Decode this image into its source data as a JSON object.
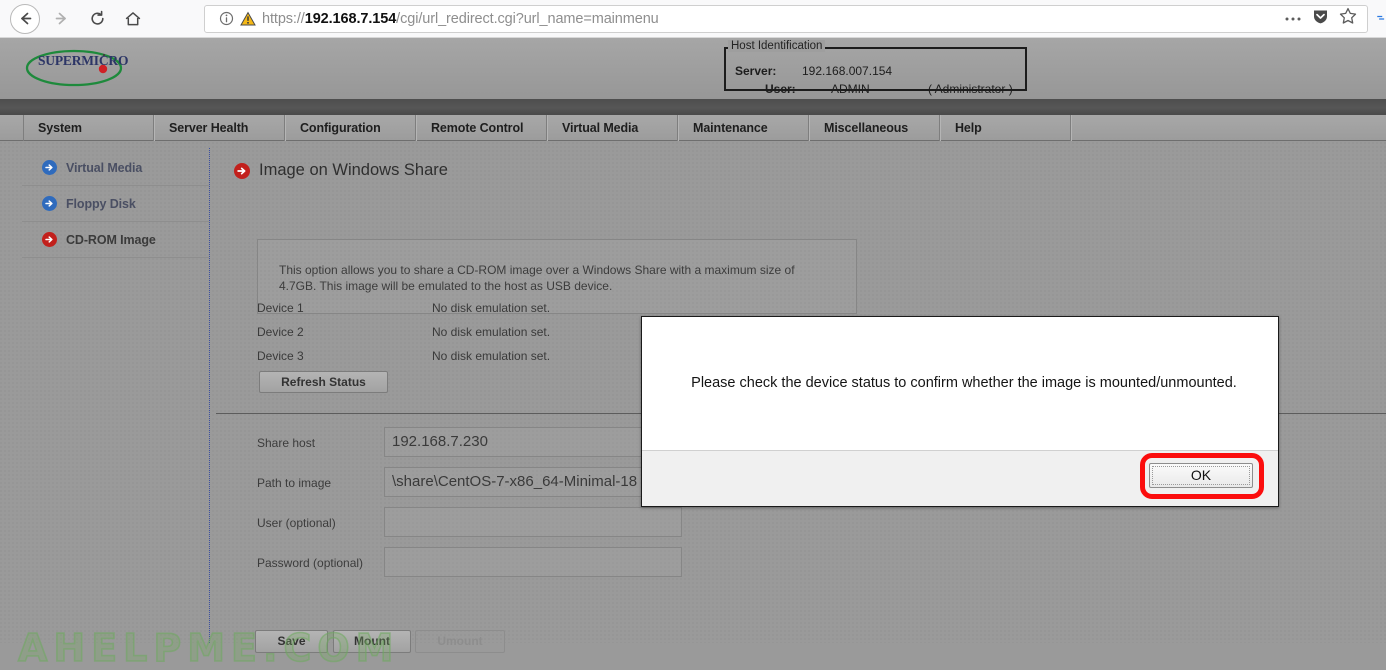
{
  "browser": {
    "back_icon": "back-arrow-icon",
    "forward_icon": "forward-arrow-icon",
    "reload_icon": "reload-icon",
    "home_icon": "home-icon",
    "url_prefix": "https://",
    "url_host": "192.168.7.154",
    "url_path": "/cgi/url_redirect.cgi?url_name=mainmenu",
    "url_full": "https://192.168.7.154/cgi/url_redirect.cgi?url_name=mainmenu",
    "identity_icon": "info-circle-icon",
    "insecure_icon": "warning-triangle-icon",
    "page_actions_icon": "ellipsis-icon",
    "pocket_icon": "pocket-shield-icon",
    "bookmark_icon": "star-icon"
  },
  "header": {
    "logo_text": "SUPERMICRO",
    "host_identification": {
      "legend": "Host Identification",
      "server_label": "Server:",
      "server_value": "192.168.007.154",
      "user_label": "User:",
      "user_value": "ADMIN",
      "user_role": "( Administrator )"
    }
  },
  "nav": {
    "items": [
      {
        "label": "System"
      },
      {
        "label": "Server Health"
      },
      {
        "label": "Configuration"
      },
      {
        "label": "Remote Control"
      },
      {
        "label": "Virtual Media"
      },
      {
        "label": "Maintenance"
      },
      {
        "label": "Miscellaneous"
      },
      {
        "label": "Help"
      }
    ]
  },
  "sidebar": {
    "items": [
      {
        "label": "Virtual Media",
        "icon": "arrow-circle-icon",
        "active": false
      },
      {
        "label": "Floppy Disk",
        "icon": "arrow-circle-icon",
        "active": false
      },
      {
        "label": "CD-ROM Image",
        "icon": "arrow-circle-icon",
        "active": true
      }
    ]
  },
  "main": {
    "title": "Image on Windows Share",
    "title_icon": "arrow-circle-icon",
    "description": "This option allows you to share a CD-ROM image over a Windows Share with a maximum size of 4.7GB. This image will be emulated to the host as USB device.",
    "devices": [
      {
        "label": "Device 1",
        "status": "No disk emulation set."
      },
      {
        "label": "Device 2",
        "status": "No disk emulation set."
      },
      {
        "label": "Device 3",
        "status": "No disk emulation set."
      }
    ],
    "refresh_button": "Refresh Status",
    "fields": [
      {
        "label": "Share host",
        "value": "192.168.7.230",
        "placeholder": ""
      },
      {
        "label": "Path to image",
        "value": "\\share\\CentOS-7-x86_64-Minimal-18",
        "placeholder": ""
      },
      {
        "label": "User (optional)",
        "value": "",
        "placeholder": ""
      },
      {
        "label": "Password (optional)",
        "value": "",
        "placeholder": ""
      }
    ],
    "buttons": {
      "save": "Save",
      "mount": "Mount",
      "umount": "Umount"
    }
  },
  "modal": {
    "message": "Please check the device status to confirm whether the image is mounted/unmounted.",
    "ok_label": "OK",
    "highlight_color": "#fb0d0d"
  },
  "watermark": {
    "text": "AHELPME.COM",
    "color": "#78aa64"
  },
  "colors": {
    "page_bg": "#9a9a9a",
    "nav_bg": "#a0a0a0",
    "accent_blue": "#2f6bbd",
    "accent_red": "#c2201c"
  }
}
